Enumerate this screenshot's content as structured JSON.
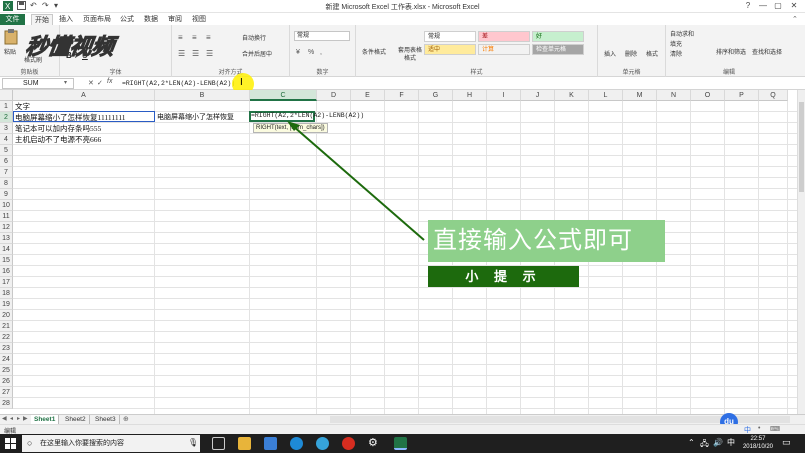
{
  "window": {
    "title": "新建 Microsoft Excel 工作表.xlsx - Microsoft Excel",
    "controls": [
      "?",
      "—",
      "▢",
      "✕"
    ]
  },
  "ribbon": {
    "tabs": [
      "文件",
      "开始",
      "插入",
      "页面布局",
      "公式",
      "数据",
      "审阅",
      "视图"
    ],
    "active_tab": "开始",
    "groups": {
      "clipboard": {
        "label": "剪贴板",
        "paste": "粘贴",
        "format_painter": "格式刷"
      },
      "font": {
        "label": "字体"
      },
      "alignment": {
        "label": "对齐方式",
        "wrap": "自动换行",
        "merge": "合并后居中"
      },
      "number": {
        "label": "数字",
        "format": "常规"
      },
      "styles": {
        "label": "样式",
        "conditional": "条件格式",
        "table": "套用表格格式",
        "cells": [
          "常规",
          "差",
          "好",
          "适中",
          "计算",
          "检查单元格"
        ]
      },
      "cells": {
        "label": "单元格",
        "insert": "插入",
        "delete": "删除",
        "format": "格式"
      },
      "editing": {
        "label": "编辑",
        "autosum": "自动求和",
        "fill": "填充",
        "clear": "清除",
        "sort": "排序和筛选",
        "find": "查找和选择"
      }
    }
  },
  "watermark": "秒懂视频",
  "formula_bar": {
    "name_box": "SUM",
    "cancel": "✕",
    "enter": "✓",
    "fx": "fx",
    "formula": "=RIGHT(A2,2*LEN(A2)-LENB(A2))"
  },
  "grid": {
    "columns": [
      "A",
      "B",
      "C",
      "D",
      "E",
      "F",
      "G",
      "H",
      "I",
      "J",
      "K",
      "L",
      "M",
      "N",
      "O",
      "P",
      "Q"
    ],
    "rows": [
      "1",
      "2",
      "3",
      "4",
      "5",
      "6",
      "7",
      "8",
      "9",
      "10",
      "11",
      "12",
      "13",
      "14",
      "15",
      "16",
      "17",
      "18",
      "19",
      "20",
      "21",
      "22",
      "23",
      "24",
      "25",
      "26",
      "27",
      "28"
    ],
    "active_column": "C",
    "active_row": "2",
    "cells": {
      "A1": "文字",
      "A2": "电脑屏幕缩小了怎样恢复11111111",
      "A3": "笔记本可以加内存条吗555",
      "A4": "主机启动不了电源不亮666",
      "B2": "电脑屏幕缩小了怎样恢复",
      "C2": "=RIGHT(A2,2*LEN(A2)-LENB(A2))"
    },
    "tooltip": "RIGHT(text, [num_chars])"
  },
  "sheets": [
    "Sheet1",
    "Sheet2",
    "Sheet3"
  ],
  "active_sheet": "Sheet1",
  "status": {
    "mode": "编辑"
  },
  "overlay": {
    "callout": "直接输入公式即可",
    "tip_label": "小 提 示",
    "arrow_color": "#1d6a0d"
  },
  "taskbar": {
    "search_placeholder": "在这里输入你要搜索的内容",
    "ime_lang": "中",
    "time": "22:57",
    "date": "2018/10/20"
  },
  "colors": {
    "accent": "#217346",
    "callout_bg": "#8ed08b",
    "tip_bg": "#1d6a0d"
  }
}
